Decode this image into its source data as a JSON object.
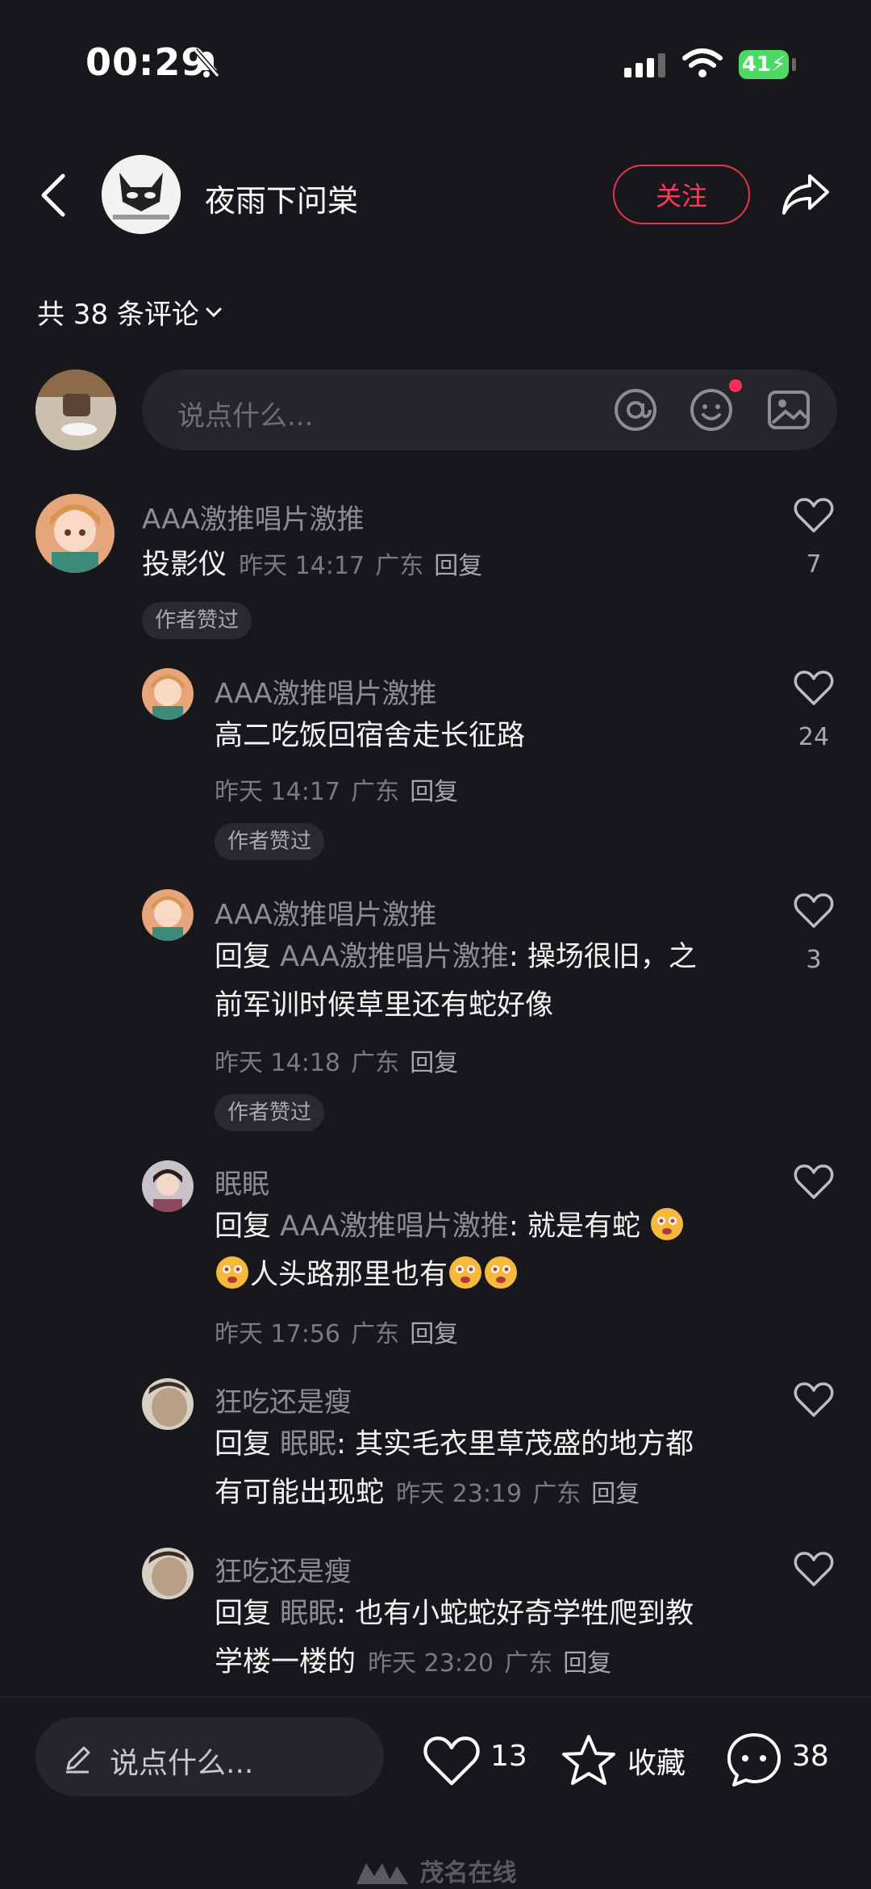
{
  "status_bar": {
    "time": "00:29",
    "battery": "41"
  },
  "header": {
    "author_name": "夜雨下问棠",
    "follow_label": "关注"
  },
  "comment_count_label": "共 38 条评论",
  "input": {
    "placeholder": "说点什么..."
  },
  "comments": [
    {
      "user": "AAA激推唱片激推",
      "text": "投影仪",
      "time": "昨天 14:17",
      "location": "广东",
      "reply": "回复",
      "tag": "作者赞过",
      "likes": "7"
    },
    {
      "user": "AAA激推唱片激推",
      "text": "高二吃饭回宿舍走长征路",
      "time": "昨天 14:17",
      "location": "广东",
      "reply": "回复",
      "tag": "作者赞过",
      "likes": "24"
    },
    {
      "user": "AAA激推唱片激推",
      "reply_prefix": "回复",
      "reply_to": "AAA激推唱片激推",
      "text_line1": ": 操场很旧，之",
      "text_line2": "前军训时候草里还有蛇好像",
      "time": "昨天 14:18",
      "location": "广东",
      "reply": "回复",
      "tag": "作者赞过",
      "likes": "3"
    },
    {
      "user": "眠眠",
      "reply_prefix": "回复",
      "reply_to": "AAA激推唱片激推",
      "text_line1": ": 就是有蛇",
      "text_line2": "人头路那里也有",
      "time": "昨天 17:56",
      "location": "广东",
      "reply": "回复"
    },
    {
      "user": "狂吃还是瘦",
      "reply_prefix": "回复",
      "reply_to": "眠眠",
      "text_line1": ": 其实毛衣里草茂盛的地方都",
      "text_line2": "有可能出现蛇",
      "time": "昨天 23:19",
      "location": "广东",
      "reply": "回复"
    },
    {
      "user": "狂吃还是瘦",
      "reply_prefix": "回复",
      "reply_to": "眠眠",
      "text_line1": ": 也有小蛇蛇好奇学牲爬到教",
      "text_line2": "学楼一楼的",
      "time": "昨天 23:20",
      "location": "广东",
      "reply": "回复"
    }
  ],
  "bottom_bar": {
    "placeholder": "说点什么...",
    "likes": "13",
    "collect_label": "收藏",
    "comments": "38"
  },
  "watermark": "茂名在线"
}
